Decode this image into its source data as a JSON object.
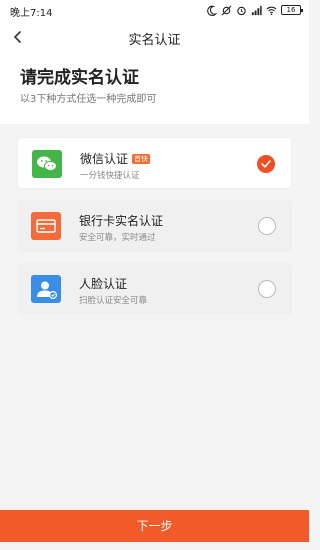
{
  "status_bar": {
    "time": "晚上7:14",
    "battery": "16"
  },
  "nav": {
    "title": "实名认证"
  },
  "header": {
    "title": "请完成实名认证",
    "subtitle": "以3下种方式任选一种完成即可"
  },
  "options": [
    {
      "title": "微信认证",
      "badge": "首快",
      "desc": "一分钱快捷认证",
      "icon": "wechat-icon",
      "color": "#44b549",
      "selected": true
    },
    {
      "title": "银行卡实名认证",
      "desc": "安全可靠，实时通过",
      "icon": "bank-card-icon",
      "color": "#f36b3a",
      "selected": false
    },
    {
      "title": "人脸认证",
      "desc": "扫脸认证安全可靠",
      "icon": "face-id-icon",
      "color": "#3b8ee8",
      "selected": false
    }
  ],
  "footer": {
    "next_label": "下一步"
  },
  "colors": {
    "accent": "#f25a2a",
    "wechat": "#44b549",
    "bank": "#f36b3a",
    "face": "#3b8ee8"
  }
}
